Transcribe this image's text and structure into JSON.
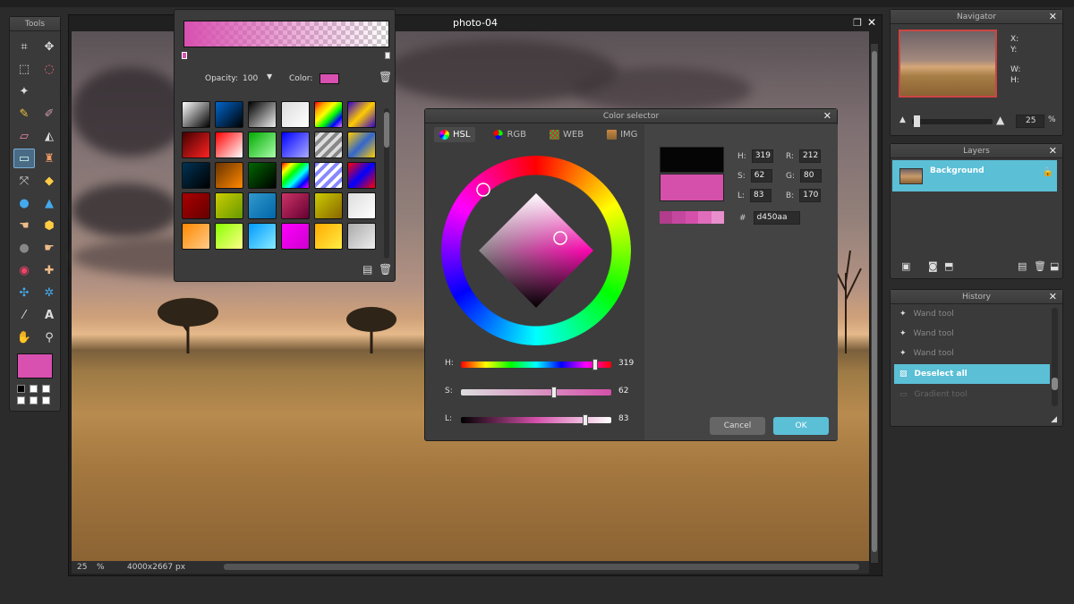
{
  "document": {
    "title": "photo-04",
    "zoom": "25",
    "size_text": "4000x2667 px"
  },
  "tools_panel": {
    "title": "Tools",
    "icons": [
      "crop-icon",
      "move-icon",
      "marquee-icon",
      "lasso-icon",
      "wand-icon",
      "spacer",
      "pencil-icon",
      "brush-icon",
      "eraser-icon",
      "bucket-icon",
      "gradient-icon",
      "stamp-icon",
      "color-replace-icon",
      "shape-icon",
      "drop-icon",
      "sharpen-icon",
      "smudge-icon",
      "sponge-icon",
      "dodge-icon",
      "burn-icon",
      "redeye-icon",
      "spotheal-icon",
      "bloat-icon",
      "pinch-icon",
      "picker-icon",
      "type-icon",
      "hand-icon",
      "zoom-icon"
    ],
    "foreground_color": "#d850b0"
  },
  "gradient_panel": {
    "opacity_label": "Opacity:",
    "opacity_value": "100",
    "color_label": "Color:",
    "color": "#d850b0"
  },
  "color_selector": {
    "title": "Color selector",
    "tabs": [
      {
        "label": "HSL",
        "active": true
      },
      {
        "label": "RGB",
        "active": false
      },
      {
        "label": "WEB",
        "active": false
      },
      {
        "label": "IMG",
        "active": false
      }
    ],
    "hsl": {
      "h_label": "H:",
      "h": "319",
      "s_label": "S:",
      "s": "62",
      "l_label": "L:",
      "l": "83"
    },
    "rgb": {
      "r_label": "R:",
      "r": "212",
      "g_label": "G:",
      "g": "80",
      "b_label": "B:",
      "b": "170"
    },
    "hex_label": "#",
    "hex": "d450aa",
    "sliders": [
      {
        "label": "H:",
        "value": "319",
        "level": 0.89
      },
      {
        "label": "S:",
        "value": "62",
        "level": 0.62
      },
      {
        "label": "L:",
        "value": "83",
        "level": 0.83
      }
    ],
    "old_color": "#050505",
    "new_color": "#d450aa",
    "cancel_label": "Cancel",
    "ok_label": "OK"
  },
  "navigator": {
    "title": "Navigator",
    "labels": [
      "X:",
      "Y:",
      "W:",
      "H:"
    ],
    "zoom_value": "25"
  },
  "layers": {
    "title": "Layers",
    "items": [
      {
        "name": "Background",
        "selected": true
      }
    ]
  },
  "history": {
    "title": "History",
    "items": [
      {
        "label": "Wand tool",
        "state": "past"
      },
      {
        "label": "Wand tool",
        "state": "past"
      },
      {
        "label": "Wand tool",
        "state": "past"
      },
      {
        "label": "Deselect all",
        "state": "current"
      },
      {
        "label": "Gradient tool",
        "state": "future"
      }
    ]
  }
}
